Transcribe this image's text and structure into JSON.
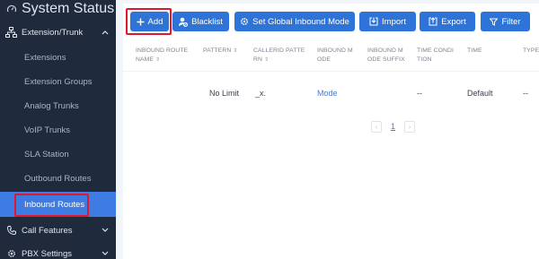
{
  "sidebar": {
    "system_status": "System Status",
    "extension_trunk": "Extension/Trunk",
    "sub_items": [
      "Extensions",
      "Extension Groups",
      "Analog Trunks",
      "VoIP Trunks",
      "SLA Station",
      "Outbound Routes",
      "Inbound Routes"
    ],
    "call_features": "Call Features",
    "pbx_settings": "PBX Settings"
  },
  "toolbar": {
    "add": "Add",
    "blacklist": "Blacklist",
    "set_global": "Set Global Inbound Mode",
    "import": "Import",
    "export": "Export",
    "filter": "Filter"
  },
  "table": {
    "headers": [
      [
        "INBOUND ROUTE",
        "NAME"
      ],
      [
        "PATTERN"
      ],
      [
        "CALLERID PATTE",
        "RN"
      ],
      [
        "INBOUND M",
        "ODE"
      ],
      [
        "INBOUND M",
        "ODE SUFFIX"
      ],
      [
        "TIME CONDI",
        "TION"
      ],
      [
        "TIME"
      ],
      [
        "TYPE"
      ]
    ],
    "row": {
      "name": "",
      "pattern": "No Limit",
      "callerid": "_x.",
      "mode": "Mode",
      "suffix": "",
      "time_condition": "--",
      "time": "Default",
      "type": "--"
    }
  },
  "pagination": {
    "current_page": "1"
  },
  "colors": {
    "sidebar_bg": "#1f2a3c",
    "accent": "#2e74d8",
    "active_item": "#3e7ce4",
    "highlight_box": "#e0182d"
  }
}
